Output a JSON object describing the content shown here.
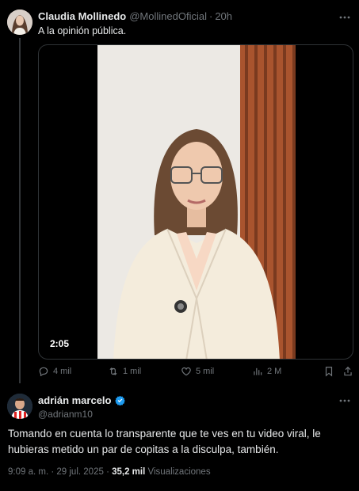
{
  "tweet1": {
    "author_name": "Claudia Mollinedo",
    "handle": "@MollinedOficial",
    "separator": "·",
    "time": "20h",
    "text": "A la opinión pública.",
    "video": {
      "duration": "2:05"
    },
    "actions": {
      "replies": "4 mil",
      "reposts": "1 mil",
      "likes": "5 mil",
      "views": "2 M"
    }
  },
  "tweet2": {
    "author_name": "adrián marcelo",
    "verified": true,
    "handle": "@adrianm10",
    "text": "Tomando en cuenta lo transparente que te ves en tu video viral, le hubieras metido un par de copitas a la disculpa, también.",
    "time": "9:09 a. m.",
    "separator": "·",
    "date": "29 jul. 2025",
    "views_count": "35,2 mil",
    "views_label": "Visualizaciones"
  },
  "colors": {
    "background": "#000000",
    "text_primary": "#e7e9ea",
    "text_secondary": "#71767b",
    "verified_blue": "#1d9bf0",
    "border": "#2f3336"
  },
  "icons": {
    "more": "more-icon",
    "reply": "reply-icon",
    "repost": "repost-icon",
    "like": "heart-icon",
    "views": "views-icon",
    "bookmark": "bookmark-icon",
    "share": "share-icon",
    "verified": "verified-badge-icon"
  }
}
